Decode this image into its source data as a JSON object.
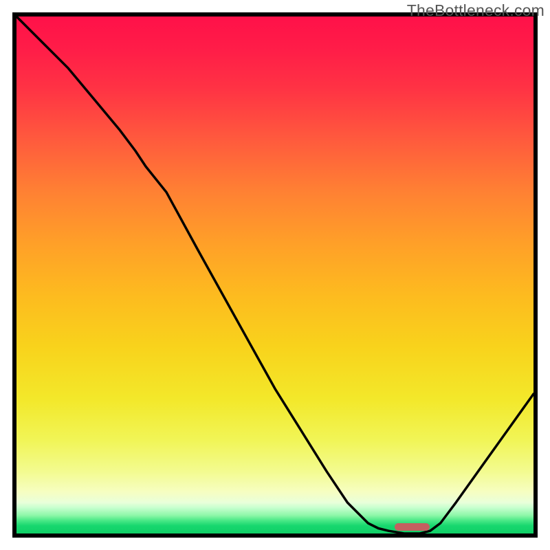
{
  "watermark": "TheBottleneck.com",
  "chart_data": {
    "type": "line",
    "title": "",
    "xlabel": "",
    "ylabel": "",
    "xlim": [
      0,
      100
    ],
    "ylim": [
      0,
      100
    ],
    "grid": false,
    "legend": false,
    "background_gradient": {
      "top": "#ff1149",
      "middle": "#f8d31c",
      "bottom": "#10d067"
    },
    "series": [
      {
        "name": "bottleneck_curve",
        "x": [
          0,
          5,
          10,
          15,
          20,
          23,
          25,
          29,
          35,
          40,
          45,
          50,
          55,
          60,
          64,
          68,
          70,
          72,
          75,
          78,
          80,
          82,
          85,
          90,
          95,
          100
        ],
        "values": [
          100,
          95,
          90,
          84,
          78,
          74,
          71,
          66,
          55,
          46,
          37,
          28,
          20,
          12,
          6,
          2,
          1,
          0.5,
          0,
          0,
          0.5,
          2,
          6,
          13,
          20,
          27
        ]
      }
    ],
    "marker": {
      "x_center": 76.5,
      "width_pct": 6.8,
      "y": 1.2,
      "color": "#c46060"
    }
  }
}
